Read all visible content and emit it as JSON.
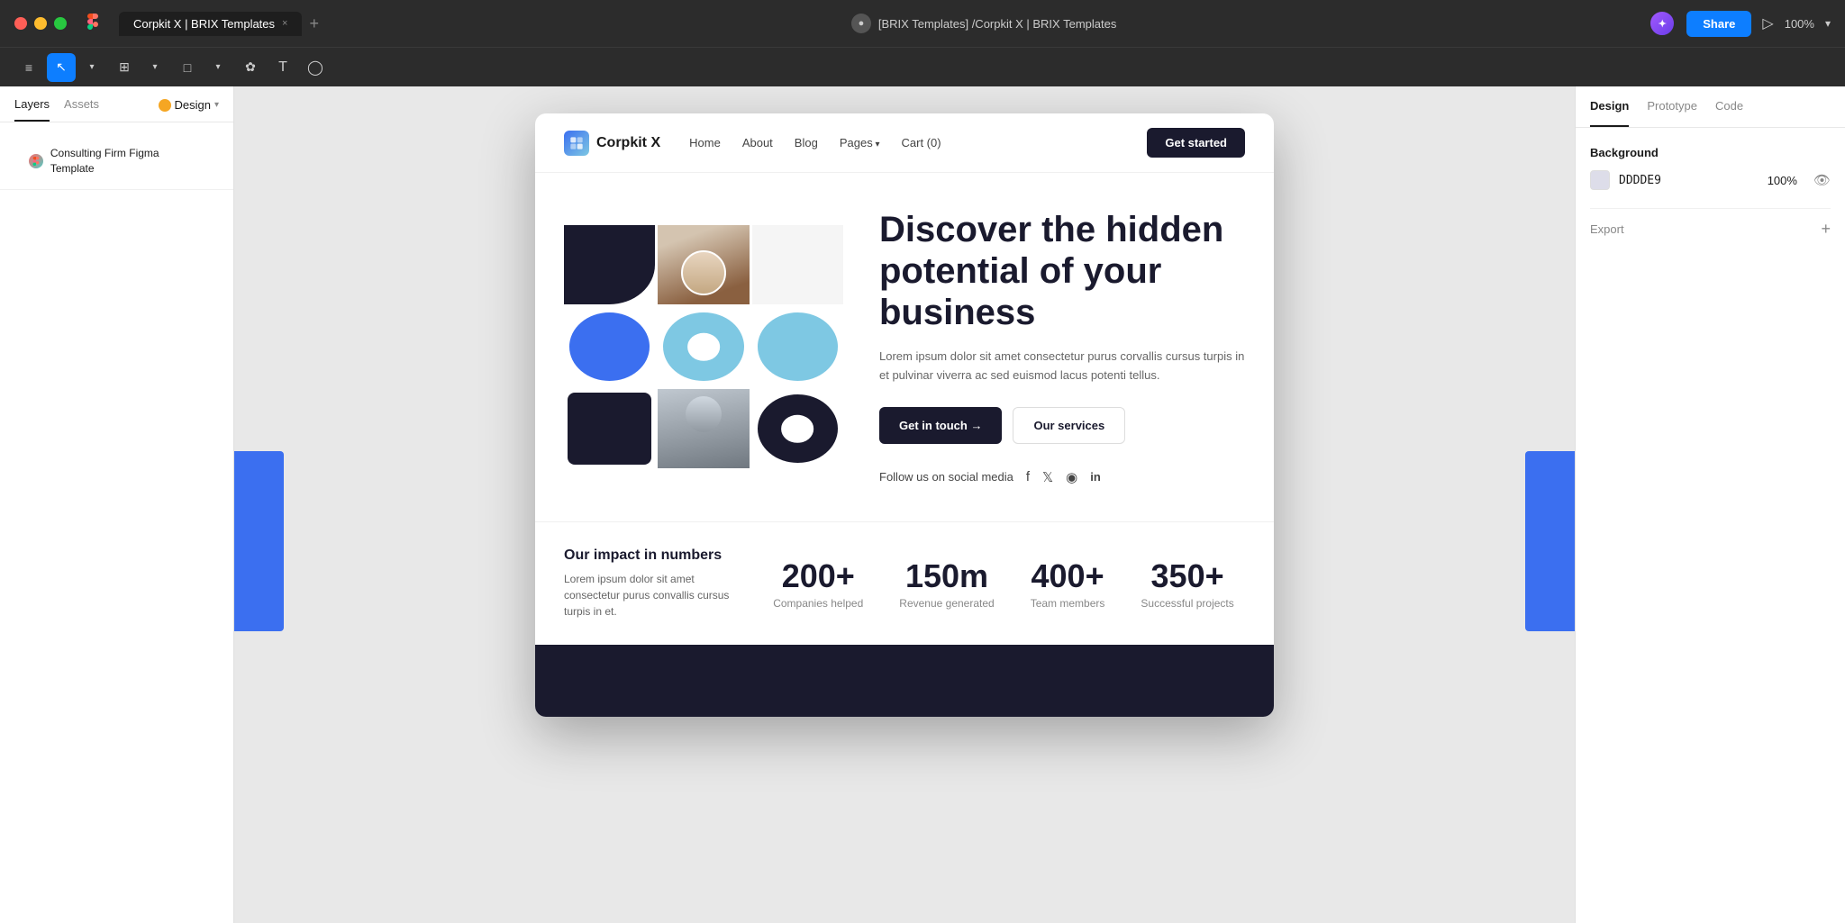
{
  "titlebar": {
    "tab_title": "Corpkit X | BRIX Templates",
    "tab_close": "×",
    "tab_plus": "+",
    "breadcrumb": "[BRIX Templates] /Corpkit X | BRIX Templates",
    "share_label": "Share",
    "zoom": "100%"
  },
  "toolbar": {
    "tools": [
      "≡",
      "▾",
      "⊞",
      "▾",
      "□",
      "▾",
      "✿",
      "T",
      "◯"
    ]
  },
  "left_panel": {
    "tab_layers": "Layers",
    "tab_assets": "Assets",
    "design_label": "Design",
    "layer_name": "Consulting Firm Figma Template"
  },
  "canvas": {
    "website": {
      "nav": {
        "logo_text": "Corpkit X",
        "links": [
          "Home",
          "About",
          "Blog",
          "Pages",
          "Cart (0)"
        ],
        "cta": "Get started"
      },
      "hero": {
        "title": "Discover the hidden potential of your business",
        "description": "Lorem ipsum dolor sit amet consectetur purus corvallis cursus turpis in et pulvinar viverra ac sed euismod lacus potenti tellus.",
        "btn_primary": "Get in touch →",
        "btn_secondary": "Our services",
        "social_label": "Follow us on social media",
        "social_icons": [
          "f",
          "t",
          "◉",
          "in"
        ]
      },
      "stats": {
        "title": "Our impact in numbers",
        "description": "Lorem ipsum dolor sit amet consectetur purus convallis cursus turpis in et.",
        "items": [
          {
            "number": "200+",
            "label": "Companies helped"
          },
          {
            "number": "150m",
            "label": "Revenue generated"
          },
          {
            "number": "400+",
            "label": "Team members"
          },
          {
            "number": "350+",
            "label": "Successful projects"
          }
        ]
      }
    }
  },
  "right_panel": {
    "tab_design": "Design",
    "tab_prototype": "Prototype",
    "tab_code": "Code",
    "background_title": "Background",
    "color_value": "DDDDE9",
    "opacity": "100%",
    "export_label": "Export"
  }
}
